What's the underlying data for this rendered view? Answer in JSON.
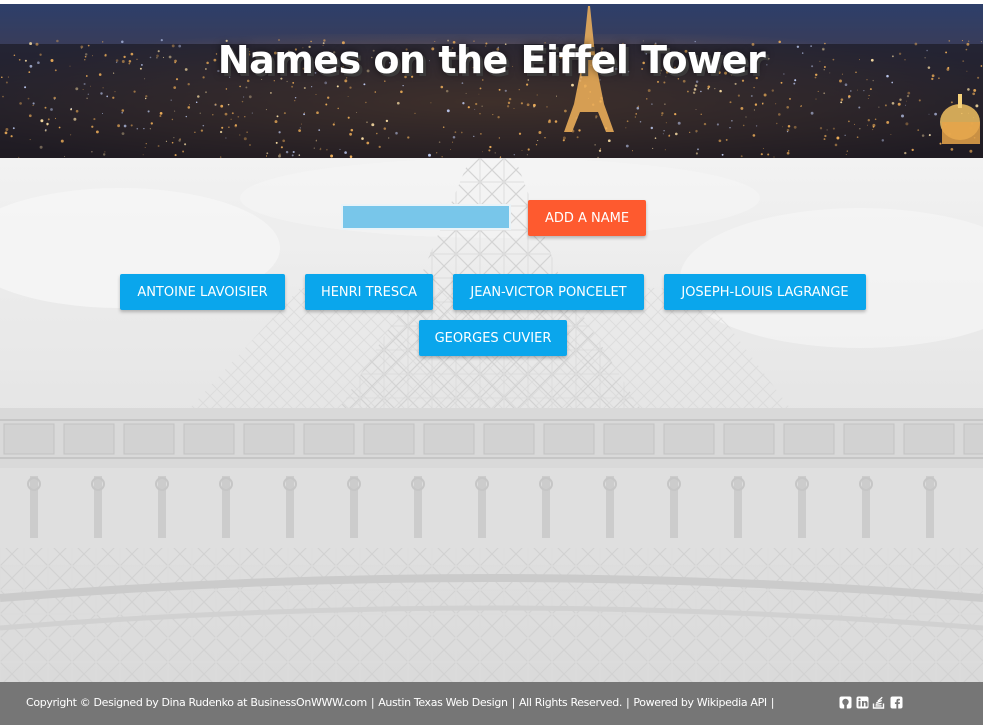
{
  "header": {
    "title": "Names on the Eiffel Tower"
  },
  "form": {
    "input_value": "",
    "add_label": "ADD A NAME"
  },
  "names": [
    "ANTOINE LAVOISIER",
    "HENRI TRESCA",
    "JEAN-VICTOR PONCELET",
    "JOSEPH-LOUIS LAGRANGE",
    "GEORGES CUVIER"
  ],
  "footer": {
    "copyright": "Copyright © Designed by Dina Rudenko at",
    "site_link": "BusinessOnWWW.com",
    "separator": "|",
    "design_link": "Austin Texas Web Design",
    "rights": "All Rights Reserved.",
    "powered_prefix": "Powered by",
    "api_link": "Wikipedia API",
    "trailing_sep": "|",
    "social_icons": [
      "github-icon",
      "linkedin-icon",
      "stackoverflow-icon",
      "facebook-icon"
    ]
  },
  "colors": {
    "accent_orange": "#fe5a2f",
    "name_button_blue": "#0aa6ec",
    "input_fill": "#78c6ea",
    "footer_bg": "#767676"
  }
}
